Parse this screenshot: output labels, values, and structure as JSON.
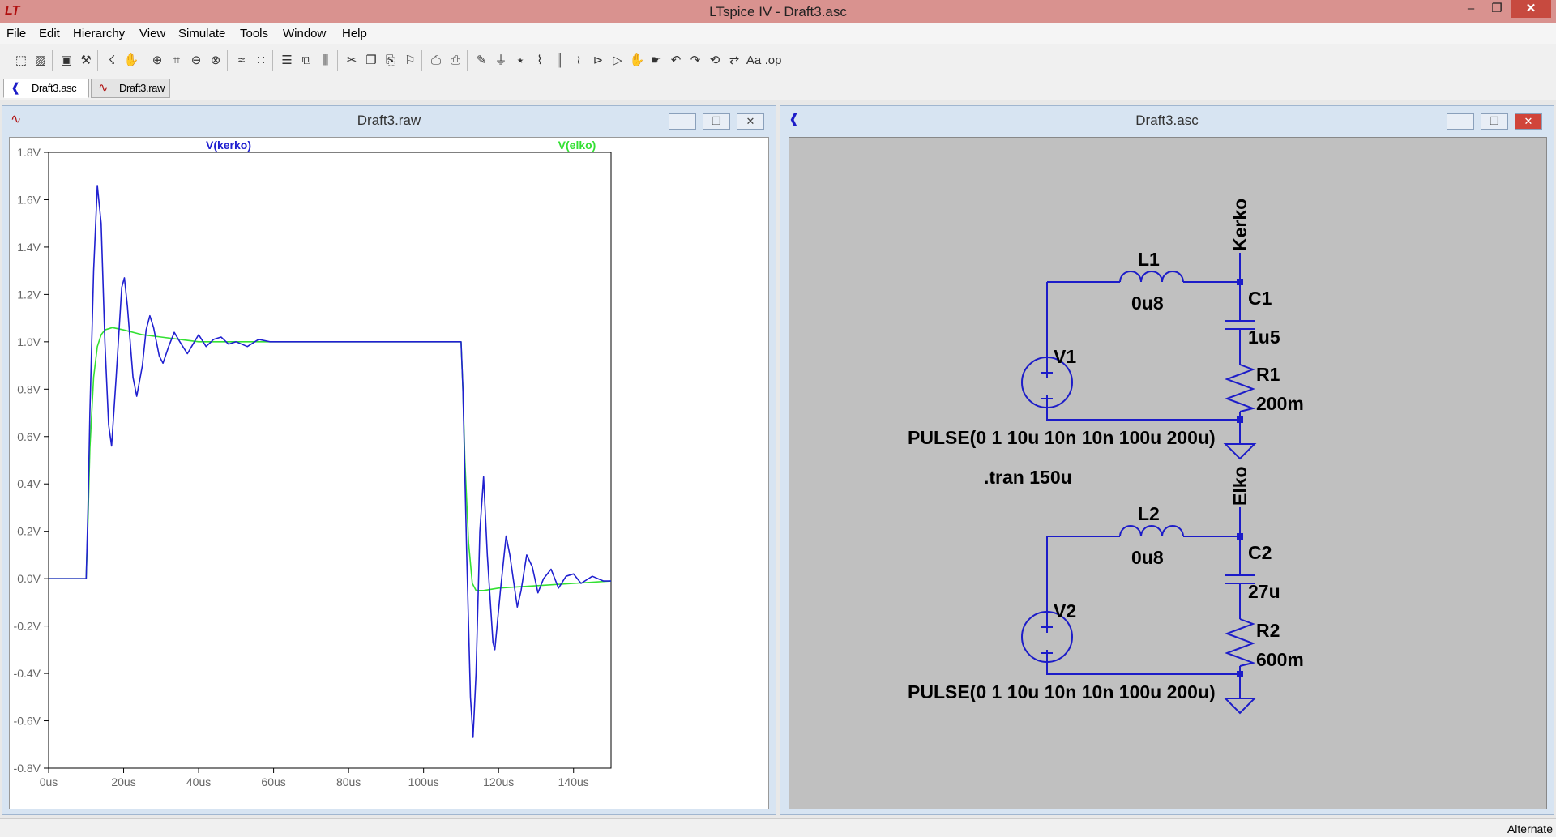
{
  "app": {
    "title": "LTspice IV - Draft3.asc",
    "window_controls": {
      "minimize": "–",
      "restore": "❐",
      "close": "✕"
    }
  },
  "menu": [
    "File",
    "Edit",
    "Hierarchy",
    "View",
    "Simulate",
    "Tools",
    "Window",
    "Help"
  ],
  "toolbar_icons": [
    "new-schematic-icon",
    "open-icon",
    "save-icon",
    "control-panel-icon",
    "run-icon",
    "halt-icon",
    "zoom-in-icon",
    "zoom-fit-icon",
    "zoom-out-icon",
    "zoom-cancel-icon",
    "autorange-icon",
    "plot-settings-icon",
    "tile-horizontal-icon",
    "cascade-icon",
    "tile-vertical-icon",
    "cut-icon",
    "copy-icon",
    "paste-icon",
    "find-icon",
    "print-setup-icon",
    "print-icon",
    "draw-wire-icon",
    "ground-icon",
    "label-net-icon",
    "resistor-icon",
    "capacitor-icon",
    "inductor-icon",
    "diode-icon",
    "component-icon",
    "move-icon",
    "drag-icon",
    "undo-icon",
    "redo-icon",
    "rotate-icon",
    "mirror-icon",
    "text-icon",
    "spice-directive-icon"
  ],
  "tabs": [
    {
      "label": "Draft3.asc",
      "icon": "schematic-icon"
    },
    {
      "label": "Draft3.raw",
      "icon": "waveform-icon"
    }
  ],
  "plot_window": {
    "title": "Draft3.raw"
  },
  "schematic_window": {
    "title": "Draft3.asc"
  },
  "status": "Alternate",
  "colors": {
    "kerko": "#2020d0",
    "elko": "#33e033",
    "wire": "#1c1cc8",
    "schematic_bg": "#c0c0c0",
    "title_bar": "#d9928f"
  },
  "chart_data": {
    "type": "line",
    "xlabel": "",
    "ylabel": "",
    "xlim": [
      0,
      150
    ],
    "ylim": [
      -0.8,
      1.8
    ],
    "x_ticks": [
      "0us",
      "20us",
      "40us",
      "60us",
      "80us",
      "100us",
      "120us",
      "140us"
    ],
    "y_ticks": [
      "1.8V",
      "1.6V",
      "1.4V",
      "1.2V",
      "1.0V",
      "0.8V",
      "0.6V",
      "0.4V",
      "0.2V",
      "0.0V",
      "-0.2V",
      "-0.4V",
      "-0.6V",
      "-0.8V"
    ],
    "grid": false,
    "x_unit": "us",
    "series": [
      {
        "name": "V(kerko)",
        "color": "#2020d0",
        "points": [
          [
            0,
            0
          ],
          [
            10,
            0
          ],
          [
            10.5,
            0.3
          ],
          [
            11,
            0.7
          ],
          [
            12,
            1.3
          ],
          [
            13,
            1.66
          ],
          [
            14,
            1.5
          ],
          [
            15,
            1.0
          ],
          [
            16,
            0.65
          ],
          [
            16.8,
            0.56
          ],
          [
            18,
            0.85
          ],
          [
            19.5,
            1.23
          ],
          [
            20.2,
            1.27
          ],
          [
            21,
            1.15
          ],
          [
            22.5,
            0.85
          ],
          [
            23.5,
            0.77
          ],
          [
            25,
            0.9
          ],
          [
            26,
            1.05
          ],
          [
            27,
            1.11
          ],
          [
            28,
            1.06
          ],
          [
            29.5,
            0.94
          ],
          [
            30.5,
            0.91
          ],
          [
            32,
            0.98
          ],
          [
            33.5,
            1.04
          ],
          [
            35,
            1.0
          ],
          [
            37,
            0.95
          ],
          [
            38.5,
            0.99
          ],
          [
            40,
            1.03
          ],
          [
            42,
            0.98
          ],
          [
            44,
            1.01
          ],
          [
            46,
            1.02
          ],
          [
            48,
            0.99
          ],
          [
            50,
            1.0
          ],
          [
            53,
            0.98
          ],
          [
            56,
            1.01
          ],
          [
            59,
            1.0
          ],
          [
            63,
            1.0
          ],
          [
            110,
            1.0
          ],
          [
            110.5,
            0.8
          ],
          [
            111.5,
            0.1
          ],
          [
            112.5,
            -0.5
          ],
          [
            113.2,
            -0.67
          ],
          [
            114,
            -0.4
          ],
          [
            115,
            0.2
          ],
          [
            116,
            0.43
          ],
          [
            117,
            0.1
          ],
          [
            118.5,
            -0.27
          ],
          [
            119,
            -0.3
          ],
          [
            120.5,
            -0.05
          ],
          [
            122,
            0.18
          ],
          [
            123,
            0.1
          ],
          [
            125,
            -0.12
          ],
          [
            126,
            -0.05
          ],
          [
            127.5,
            0.1
          ],
          [
            129,
            0.05
          ],
          [
            130.5,
            -0.06
          ],
          [
            132,
            0.0
          ],
          [
            134,
            0.04
          ],
          [
            136,
            -0.04
          ],
          [
            138,
            0.01
          ],
          [
            140,
            0.02
          ],
          [
            142,
            -0.02
          ],
          [
            145,
            0.01
          ],
          [
            148,
            -0.01
          ],
          [
            150,
            -0.01
          ]
        ]
      },
      {
        "name": "V(elko)",
        "color": "#33e033",
        "points": [
          [
            0,
            0
          ],
          [
            10,
            0
          ],
          [
            10.5,
            0.25
          ],
          [
            11,
            0.55
          ],
          [
            12,
            0.85
          ],
          [
            13,
            0.98
          ],
          [
            14,
            1.03
          ],
          [
            15,
            1.05
          ],
          [
            17,
            1.06
          ],
          [
            20,
            1.05
          ],
          [
            25,
            1.03
          ],
          [
            30,
            1.02
          ],
          [
            35,
            1.01
          ],
          [
            40,
            1.0
          ],
          [
            50,
            1.0
          ],
          [
            110,
            1.0
          ],
          [
            110.5,
            0.8
          ],
          [
            111,
            0.5
          ],
          [
            112,
            0.15
          ],
          [
            113,
            -0.02
          ],
          [
            114,
            -0.05
          ],
          [
            116,
            -0.05
          ],
          [
            120,
            -0.04
          ],
          [
            130,
            -0.03
          ],
          [
            140,
            -0.02
          ],
          [
            150,
            -0.01
          ]
        ]
      }
    ]
  },
  "schematic": {
    "labels": {
      "net_top": "Kerko",
      "net_bottom": "Elko",
      "L1": "L1",
      "L1_val": "0u8",
      "C1": "C1",
      "C1_val": "1u5",
      "R1": "R1",
      "R1_val": "200m",
      "V1": "V1",
      "L2": "L2",
      "L2_val": "0u8",
      "C2": "C2",
      "C2_val": "27u",
      "R2": "R2",
      "R2_val": "600m",
      "V2": "V2",
      "pulse1": "PULSE(0 1 10u 10n 10n 100u 200u)",
      "pulse2": "PULSE(0 1 10u 10n 10n 100u 200u)",
      "directive": ".tran 150u"
    }
  }
}
